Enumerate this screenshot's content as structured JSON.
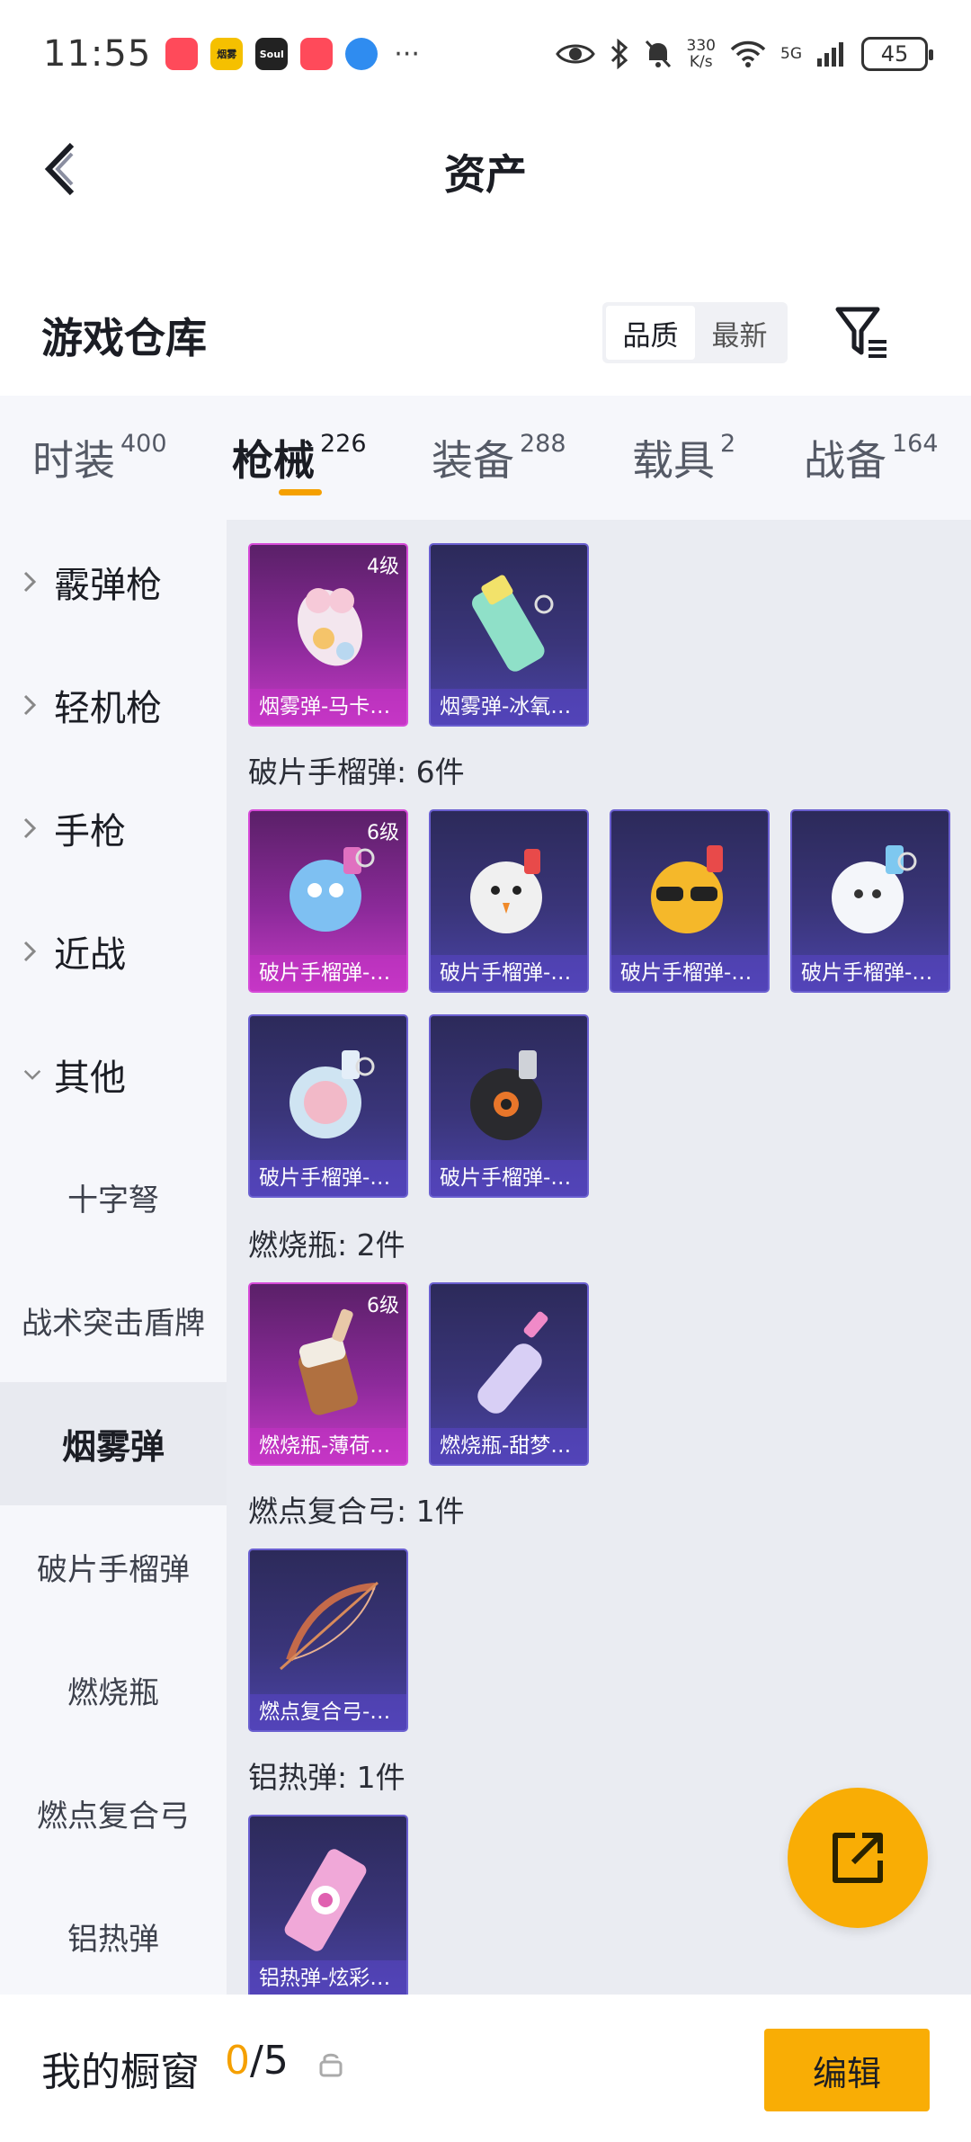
{
  "status_bar": {
    "time": "11:55",
    "app_icons": [
      {
        "name": "red-bag-app",
        "label": "",
        "color": "#ff4a5a"
      },
      {
        "name": "yellow-app",
        "label": "烟雾",
        "color": "#f5c000"
      },
      {
        "name": "soul-app",
        "label": "Soul",
        "color": "#222222"
      },
      {
        "name": "red-bag-app-2",
        "label": "",
        "color": "#ff4a5a"
      },
      {
        "name": "blue-globe-app",
        "label": "",
        "color": "#2f8cf0"
      }
    ],
    "more": "···",
    "net_speed_value": "330",
    "net_speed_unit": "K/s",
    "network": "5G",
    "battery": "45"
  },
  "nav": {
    "title": "资产"
  },
  "warehouse": {
    "title": "游戏仓库",
    "sort_options": [
      "品质",
      "最新"
    ]
  },
  "tabs": [
    {
      "label": "时装",
      "count": "400"
    },
    {
      "label": "枪械",
      "count": "226"
    },
    {
      "label": "装备",
      "count": "288"
    },
    {
      "label": "载具",
      "count": "2"
    },
    {
      "label": "战备",
      "count": "164"
    }
  ],
  "sidebar": {
    "parents": [
      "霰弹枪",
      "轻机枪",
      "手枪",
      "近战",
      "其他"
    ],
    "children": [
      "十字弩",
      "战术突击盾牌",
      "烟雾弹",
      "破片手榴弹",
      "燃烧瓶",
      "燃点复合弓",
      "铝热弹"
    ]
  },
  "groups": [
    {
      "title": "",
      "items": [
        {
          "caption": "烟雾弹-马卡…",
          "level": "4级"
        },
        {
          "caption": "烟雾弹-冰氧…",
          "level": ""
        }
      ]
    },
    {
      "title": "破片手榴弹: 6件",
      "items": [
        {
          "caption": "破片手榴弹-…",
          "level": "6级"
        },
        {
          "caption": "破片手榴弹-…",
          "level": ""
        },
        {
          "caption": "破片手榴弹-…",
          "level": ""
        },
        {
          "caption": "破片手榴弹-…",
          "level": ""
        },
        {
          "caption": "破片手榴弹-…",
          "level": ""
        },
        {
          "caption": "破片手榴弹-…",
          "level": ""
        }
      ]
    },
    {
      "title": "燃烧瓶: 2件",
      "items": [
        {
          "caption": "燃烧瓶-薄荷…",
          "level": "6级"
        },
        {
          "caption": "燃烧瓶-甜梦…",
          "level": ""
        }
      ]
    },
    {
      "title": "燃点复合弓: 1件",
      "items": [
        {
          "caption": "燃点复合弓-…",
          "level": ""
        }
      ]
    },
    {
      "title": "铝热弹: 1件",
      "items": [
        {
          "caption": "铝热弹-炫彩…",
          "level": ""
        }
      ]
    }
  ],
  "showcase": {
    "title": "我的橱窗",
    "current": "0",
    "total": "/5",
    "edit_label": "编辑"
  },
  "colors": {
    "accent": "#f9ad05",
    "tab_underline": "#f5a000",
    "card_purple": "#3a357a",
    "card_pink": "#8c2a9a"
  }
}
